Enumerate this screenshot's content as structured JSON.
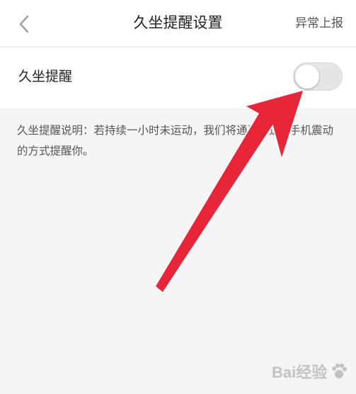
{
  "navbar": {
    "title": "久坐提醒设置",
    "report_label": "异常上报",
    "back_icon": "chevron-left-icon"
  },
  "setting": {
    "label": "久坐提醒",
    "toggle_on": false
  },
  "description": {
    "text": "久坐提醒说明：若持续一小时未运动，我们将通过推送+手机震动的方式提醒你。"
  },
  "overlay": {
    "arrow_color": "#e8263a"
  },
  "watermark": {
    "text": "Bai经验"
  }
}
